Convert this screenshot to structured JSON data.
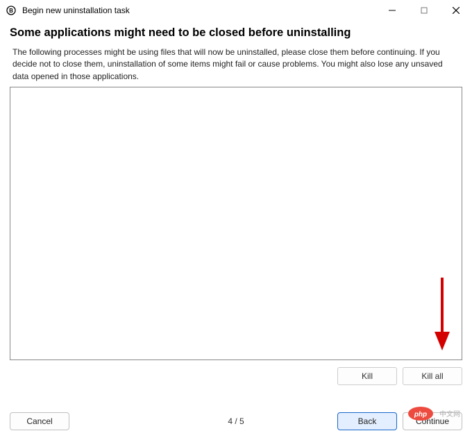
{
  "titlebar": {
    "title": "Begin new uninstallation task"
  },
  "page": {
    "heading": "Some applications might need to be closed before uninstalling",
    "description": "The following processes might be using files that will now be uninstalled, please close them before continuing. If you decide not to close them, uninstallation of some items might fail or cause problems. You might also lose any unsaved data opened in those applications."
  },
  "buttons": {
    "kill": "Kill",
    "kill_all": "Kill all",
    "cancel": "Cancel",
    "back": "Back",
    "continue": "Continue"
  },
  "progress": {
    "step_text": "4 / 5"
  },
  "watermark": {
    "text": "php 中文网"
  },
  "annotation": {
    "arrow_color": "#d40000"
  }
}
